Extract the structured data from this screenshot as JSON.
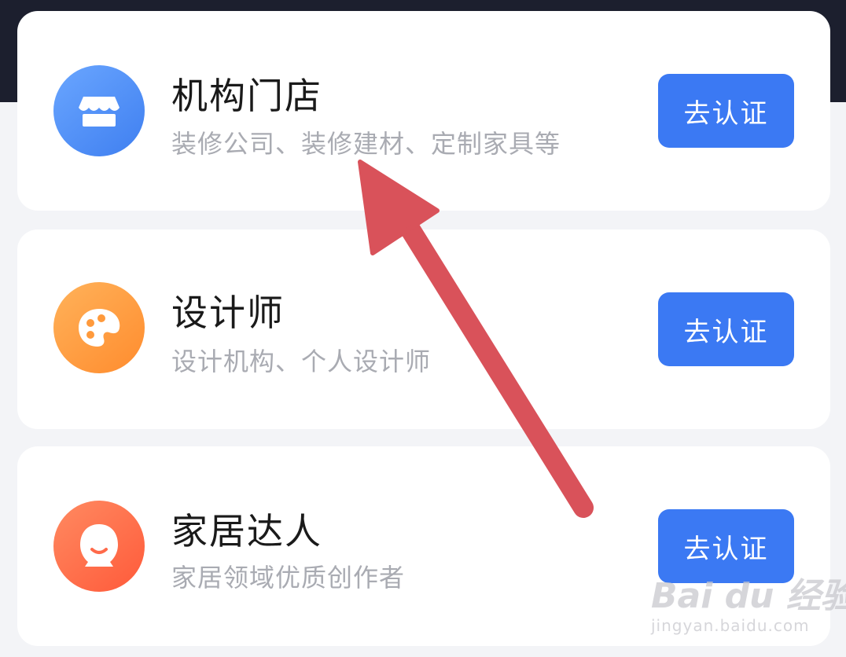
{
  "cards": [
    {
      "title": "机构门店",
      "subtitle": "装修公司、装修建材、定制家具等",
      "button_label": "去认证",
      "icon": "store-icon",
      "icon_color": "#4a8cf6"
    },
    {
      "title": "设计师",
      "subtitle": "设计机构、个人设计师",
      "button_label": "去认证",
      "icon": "palette-icon",
      "icon_color": "#ff9d43"
    },
    {
      "title": "家居达人",
      "subtitle": "家居领域优质创作者",
      "button_label": "去认证",
      "icon": "person-icon",
      "icon_color": "#ff6d4a"
    }
  ],
  "colors": {
    "button": "#3b79f3",
    "annotation_arrow": "#d9525a",
    "top_band": "#1c1f2e"
  },
  "watermark": {
    "brand": "Bai du 经验",
    "url": "jingyan.baidu.com"
  }
}
